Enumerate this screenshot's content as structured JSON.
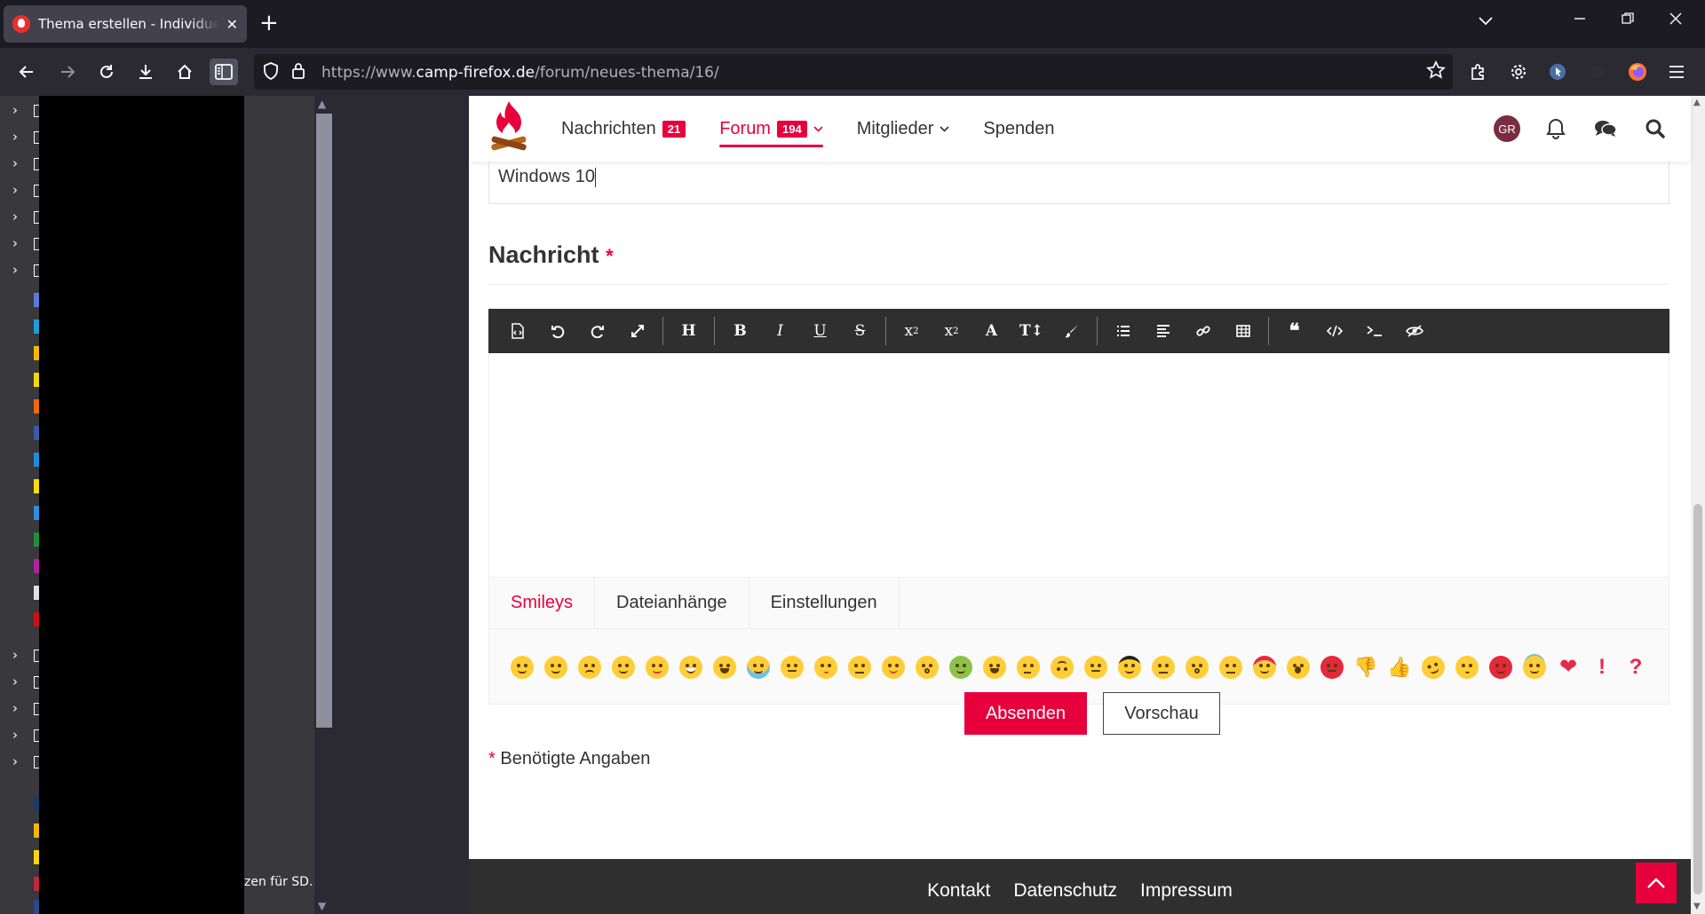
{
  "browser": {
    "tab_title": "Thema erstellen - Individuelle A",
    "tab_close": "✕",
    "new_tab": "+",
    "url_prefix": "https://www.",
    "url_domain": "camp-firefox.de",
    "url_path": "/forum/neues-thema/16/"
  },
  "sidebar": {
    "truncated_text": "zen für SD..."
  },
  "site": {
    "nav": [
      {
        "label": "Nachrichten",
        "badge": "21"
      },
      {
        "label": "Forum",
        "badge": "194"
      },
      {
        "label": "Mitglieder"
      },
      {
        "label": "Spenden"
      }
    ],
    "avatar_initials": "GR",
    "subject_value": "Windows 10",
    "message_label": "Nachricht",
    "required_mark": "*",
    "editor_tabs": [
      "Smileys",
      "Dateianhänge",
      "Einstellungen"
    ],
    "submit_label": "Absenden",
    "preview_label": "Vorschau",
    "required_note": "Benötigte Angaben",
    "footer_links": [
      "Kontakt",
      "Datenschutz",
      "Impressum"
    ],
    "accent_color": "#e8003d"
  }
}
